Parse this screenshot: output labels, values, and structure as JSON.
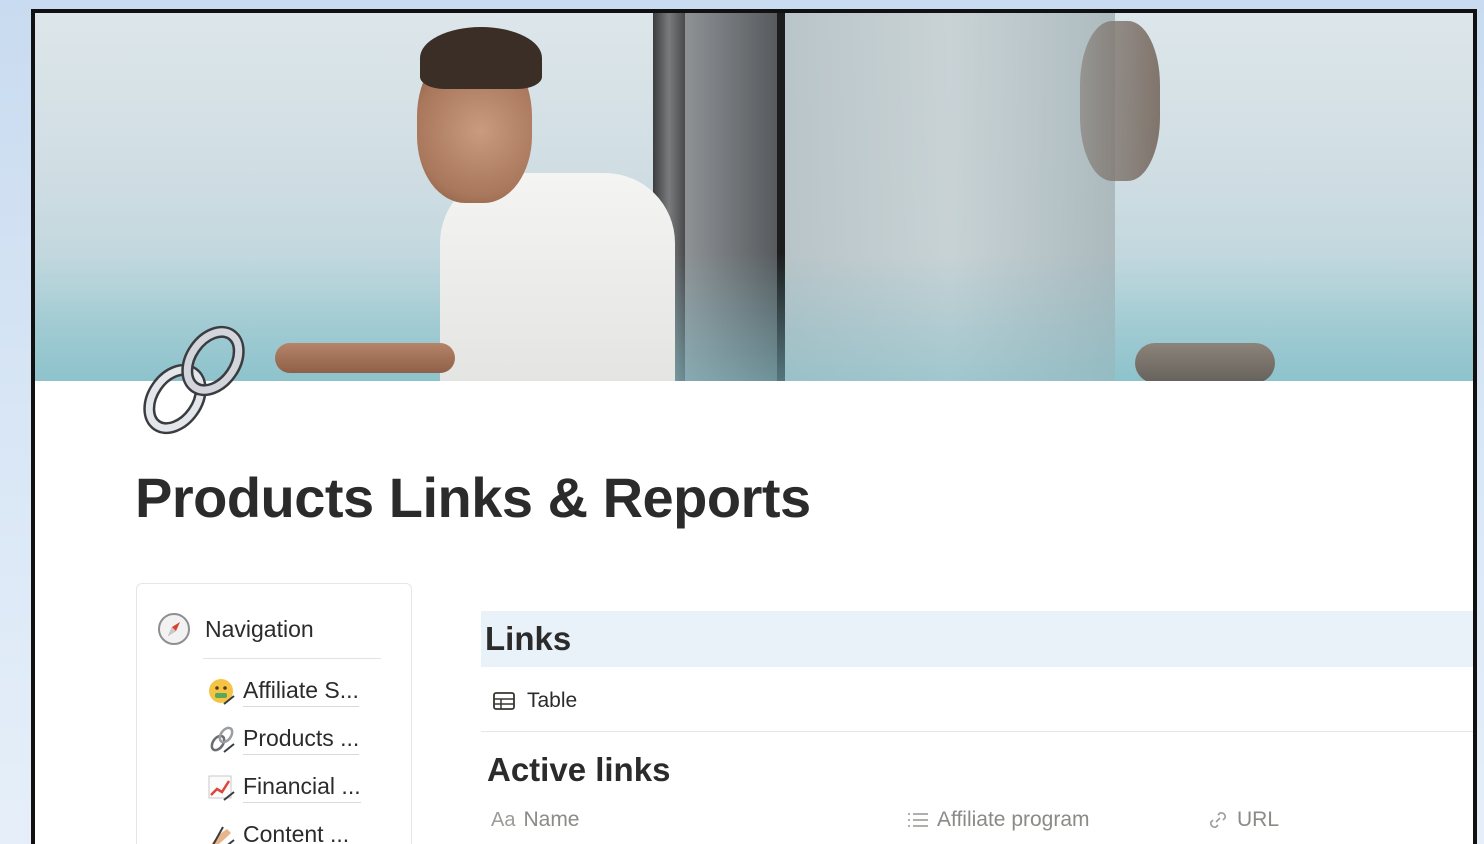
{
  "page": {
    "title": "Products Links & Reports"
  },
  "navigation": {
    "header_label": "Navigation",
    "header_icon": "compass-icon",
    "items": [
      {
        "label": "Affiliate S...",
        "icon": "money-mouth-face-icon"
      },
      {
        "label": "Products ...",
        "icon": "link-icon"
      },
      {
        "label": "Financial ...",
        "icon": "chart-increasing-icon"
      },
      {
        "label": "Content ...",
        "icon": "writing-hand-icon"
      }
    ]
  },
  "database": {
    "title": "Links",
    "view_tab_label": "Table",
    "view_tab_icon": "table-icon",
    "section_title": "Active links",
    "columns": [
      {
        "label": "Name",
        "icon_text": "Aa"
      },
      {
        "label": "Affiliate program",
        "icon": "list-icon"
      },
      {
        "label": "URL",
        "icon": "link-icon"
      }
    ]
  },
  "colors": {
    "header_background": "#e9f2f8",
    "text": "#2b2b2b",
    "muted_text": "#8a8a87"
  }
}
